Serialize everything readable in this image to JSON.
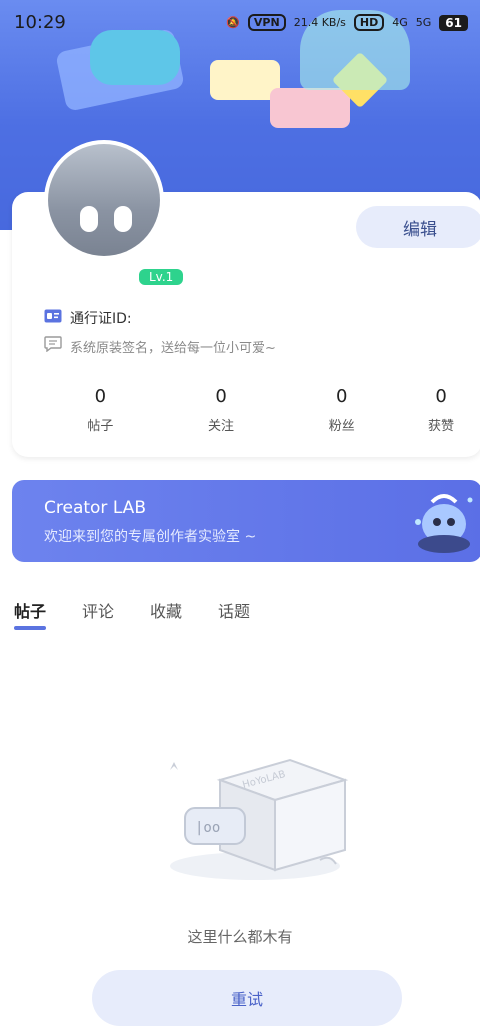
{
  "status_bar": {
    "time": "10:29",
    "net_speed": "21.4 KB/s",
    "vpn": "VPN",
    "hd": "HD",
    "sig1": "4G",
    "sig2": "5G",
    "battery": "61"
  },
  "profile": {
    "level": "Lv.1",
    "edit_label": "编辑",
    "id_label": "通行证ID:",
    "signature": "系统原装签名，送给每一位小可爱~"
  },
  "stats": [
    {
      "value": "0",
      "label": "帖子"
    },
    {
      "value": "0",
      "label": "关注"
    },
    {
      "value": "0",
      "label": "粉丝"
    },
    {
      "value": "0",
      "label": "获赞"
    }
  ],
  "creator_lab": {
    "title": "Creator LAB",
    "subtitle": "欢迎来到您的专属创作者实验室 ~"
  },
  "tabs": [
    {
      "label": "帖子",
      "active": true
    },
    {
      "label": "评论",
      "active": false
    },
    {
      "label": "收藏",
      "active": false
    },
    {
      "label": "话题",
      "active": false
    }
  ],
  "empty": {
    "box_brand": "HoYoLAB",
    "bubble_text": "|oo",
    "message": "这里什么都木有",
    "retry_label": "重试"
  },
  "colors": {
    "accent": "#5b73e0",
    "level_badge": "#2ed38d",
    "edit_bg": "#e7ecfb"
  }
}
